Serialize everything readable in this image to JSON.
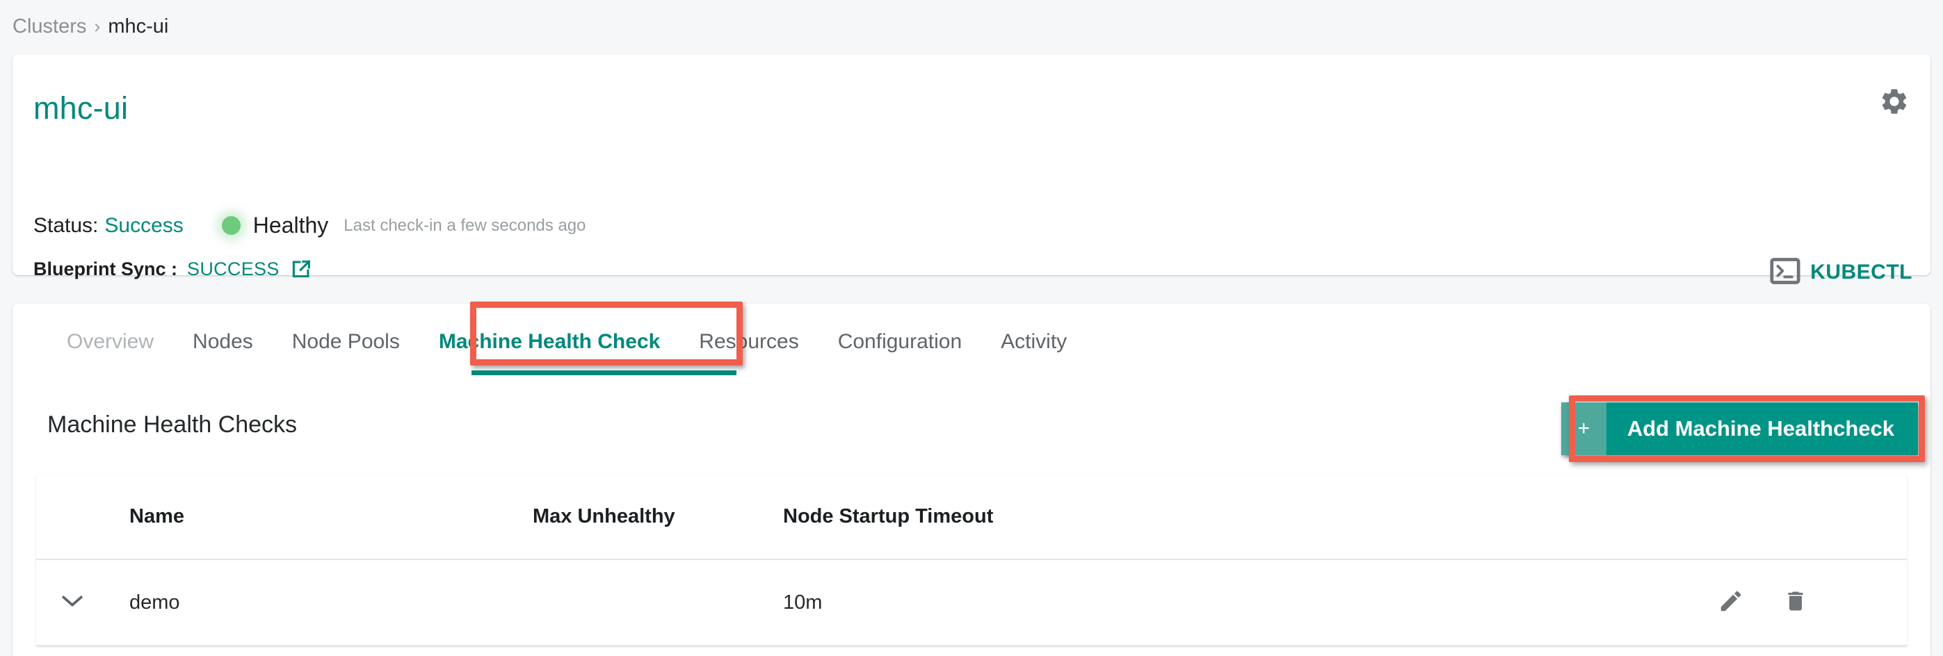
{
  "breadcrumb": {
    "root": "Clusters",
    "separator": "›",
    "leaf": "mhc-ui"
  },
  "summary": {
    "title": "mhc-ui",
    "status_label": "Status:",
    "status_value": "Success",
    "health_text": "Healthy",
    "health_dot_color": "#6ecb7e",
    "last_checkin": "Last check-in a few seconds ago",
    "sync_label": "Blueprint Sync :",
    "sync_value": "SUCCESS",
    "kubectl_label": "KUBECTL",
    "accent_color": "#00897b"
  },
  "tabs": [
    {
      "label": "Overview",
      "state": "muted"
    },
    {
      "label": "Nodes",
      "state": "plain"
    },
    {
      "label": "Node Pools",
      "state": "plain"
    },
    {
      "label": "Machine Health Check",
      "state": "active"
    },
    {
      "label": "Resources",
      "state": "plain"
    },
    {
      "label": "Configuration",
      "state": "plain"
    },
    {
      "label": "Activity",
      "state": "plain"
    }
  ],
  "main": {
    "section_title": "Machine Health Checks",
    "add_button": {
      "plus": "+",
      "label": "Add Machine Healthcheck"
    },
    "highlight_color": "#ef5f4c",
    "table": {
      "columns": [
        "Name",
        "Max Unhealthy",
        "Node Startup Timeout"
      ],
      "rows": [
        {
          "name": "demo",
          "max_unhealthy": "",
          "node_startup_timeout": "10m"
        }
      ]
    }
  }
}
